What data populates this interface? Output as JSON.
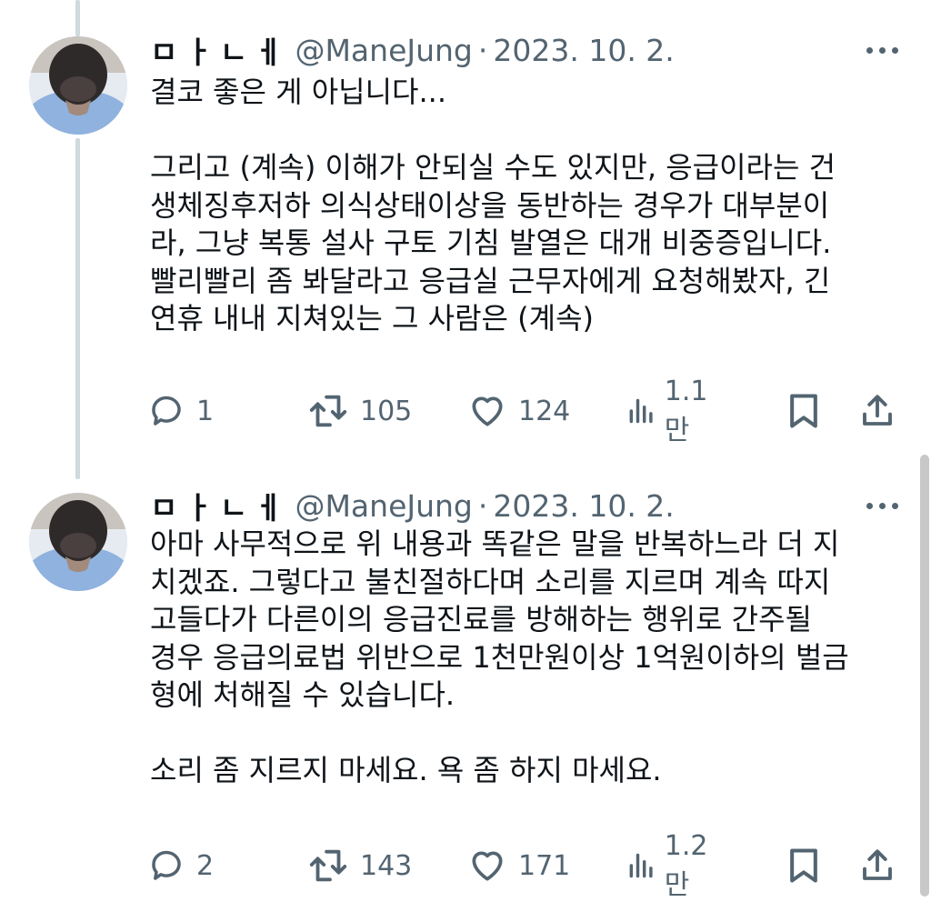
{
  "tweets": [
    {
      "author_name": "ㅁㅏㄴㅔ",
      "handle": "@ManeJung",
      "separator": "·",
      "date": "2023. 10. 2.",
      "text_lines": [
        "결코 좋은 게 아닙니다...",
        "",
        "그리고 (계속) 이해가 안되실 수도 있지만, 응급이라는 건",
        "생체징후저하 의식상태이상을 동반하는 경우가 대부분이",
        "라, 그냥 복통 설사 구토 기침 발열은 대개 비중증입니다.",
        "빨리빨리 좀 봐달라고 응급실 근무자에게 요청해봤자, 긴",
        "연휴 내내 지쳐있는 그 사람은 (계속)"
      ],
      "replies": "1",
      "retweets": "105",
      "likes": "124",
      "views": "1.1만"
    },
    {
      "author_name": "ㅁㅏㄴㅔ",
      "handle": "@ManeJung",
      "separator": "·",
      "date": "2023. 10. 2.",
      "text_lines": [
        "아마 사무적으로 위 내용과 똑같은 말을 반복하느라 더 지",
        "치겠죠. 그렇다고 불친절하다며 소리를 지르며 계속 따지",
        "고들다가 다른이의 응급진료를 방해하는 행위로 간주될",
        "경우 응급의료법 위반으로 1천만원이상 1억원이하의 벌금",
        "형에 처해질 수 있습니다.",
        "",
        "소리 좀 지르지 마세요. 욕 좀 하지 마세요."
      ],
      "replies": "2",
      "retweets": "143",
      "likes": "171",
      "views": "1.2만"
    }
  ],
  "icons": {
    "reply": "speech-bubble-icon",
    "retweet": "retweet-arrows-icon",
    "like": "heart-icon",
    "views": "bar-chart-icon",
    "bookmark": "bookmark-icon",
    "share": "share-upload-icon"
  },
  "colors": {
    "text": "#0f1419",
    "secondary": "#536471",
    "thread_line": "#cfd9de"
  }
}
